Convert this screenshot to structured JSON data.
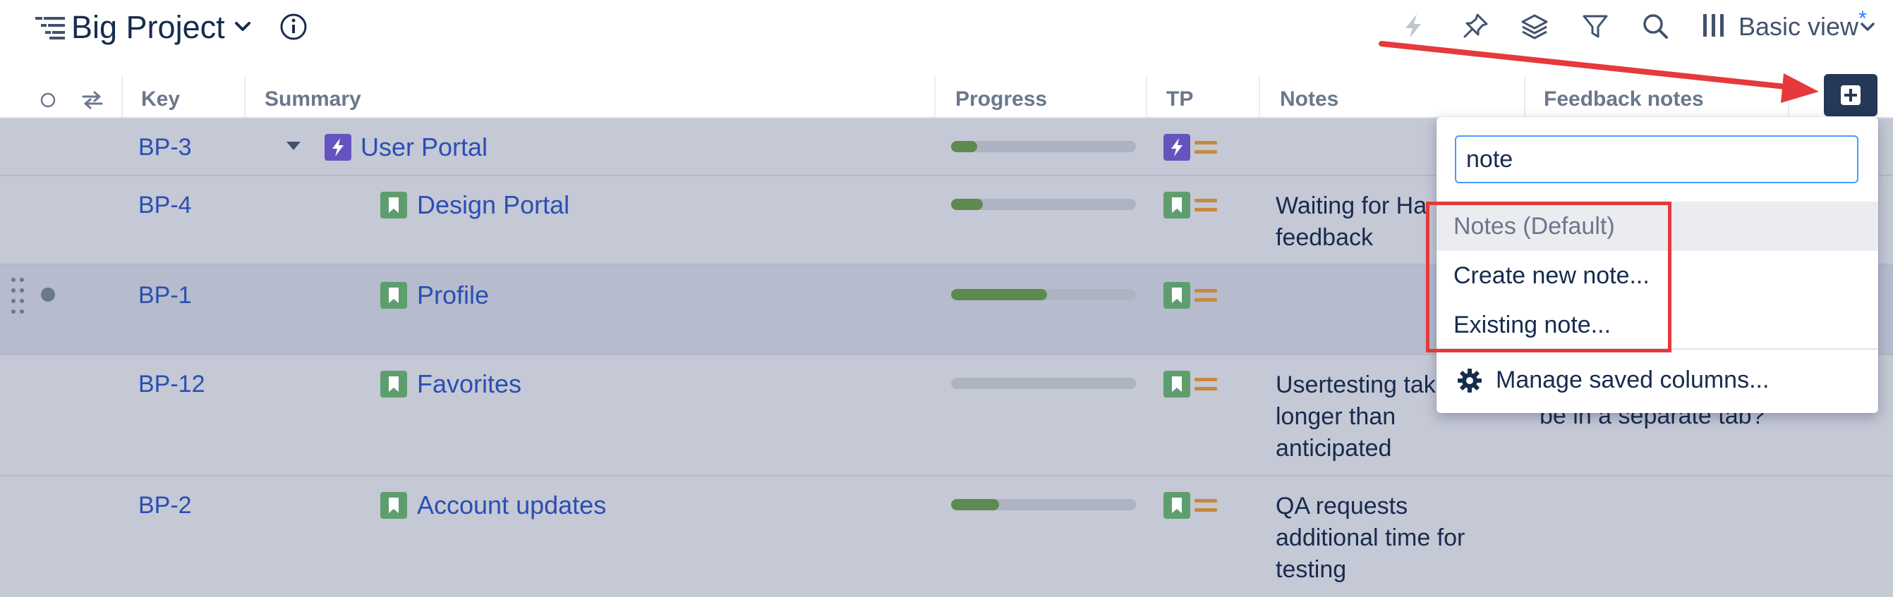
{
  "header": {
    "project_title": "Big Project",
    "view_label": "Basic view",
    "view_modified_marker": "*",
    "toolbar_icons": [
      "lightning-icon",
      "pin-icon",
      "layers-icon",
      "filter-icon",
      "search-icon",
      "columns-icon"
    ]
  },
  "columns": {
    "key": "Key",
    "summary": "Summary",
    "progress": "Progress",
    "tp": "TP",
    "notes": "Notes",
    "feedback_notes": "Feedback notes"
  },
  "rows": [
    {
      "key": "BP-3",
      "summary": "User Portal",
      "type": "epic",
      "progress": 0.14,
      "notes": [],
      "feedback": []
    },
    {
      "key": "BP-4",
      "summary": "Design Portal",
      "type": "story",
      "progress": 0.17,
      "notes": [
        "Waiting for Ha",
        "feedback"
      ],
      "feedback": []
    },
    {
      "key": "BP-1",
      "summary": "Profile",
      "type": "story",
      "progress": 0.52,
      "notes": [],
      "feedback": []
    },
    {
      "key": "BP-12",
      "summary": "Favorites",
      "type": "story",
      "progress": 0.0,
      "notes": [
        "Usertesting tak",
        "longer than",
        "anticipated"
      ],
      "feedback": [
        "be in a separate tab?"
      ]
    },
    {
      "key": "BP-2",
      "summary": "Account updates",
      "type": "story",
      "progress": 0.26,
      "notes": [
        "QA requests",
        "additional time for",
        "testing"
      ],
      "feedback": []
    }
  ],
  "dropdown": {
    "search_value": "note",
    "items": [
      "Notes (Default)",
      "Create new note...",
      "Existing note..."
    ],
    "manage_label": "Manage saved columns..."
  },
  "colors": {
    "epic": "#6554c0",
    "story": "#5e9e6e",
    "progress_fill": "#5c8a50",
    "link": "#2a4fb3",
    "annotation": "#e5393c",
    "add_button": "#253858"
  }
}
